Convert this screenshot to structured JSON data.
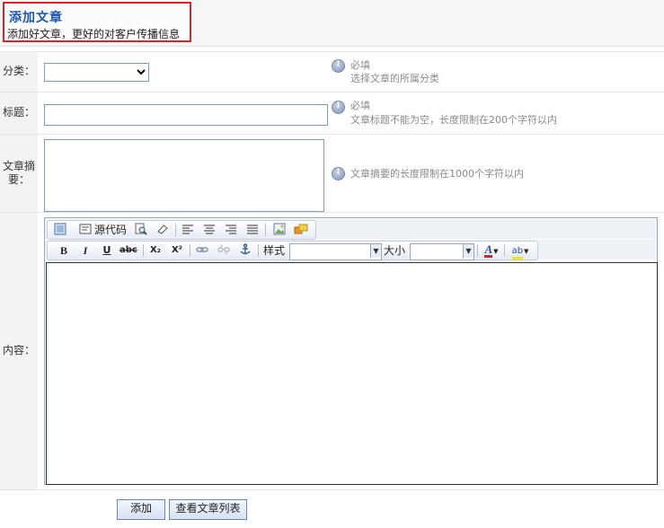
{
  "header": {
    "title": "添加文章",
    "subtitle": "添加好文章，更好的对客户传播信息"
  },
  "form": {
    "category": {
      "label": "分类：",
      "selected": "",
      "hint_required": "必填",
      "hint_text": "选择文章的所属分类"
    },
    "title_field": {
      "label": "标题：",
      "value": "",
      "hint_required": "必填",
      "hint_text": "文章标题不能为空，长度限制在200个字符以内"
    },
    "summary": {
      "label_line1": "文章摘",
      "label_line2": "要：",
      "value": "",
      "hint_text": "文章摘要的长度限制在1000个字符以内"
    },
    "content": {
      "label": "内容："
    }
  },
  "editor": {
    "toolbar_row1": [
      {
        "name": "template-icon"
      },
      {
        "name": "source-code-icon",
        "label": "源代码"
      },
      {
        "name": "preview-icon"
      },
      {
        "name": "eraser-icon"
      },
      {
        "name": "align-left-icon"
      },
      {
        "name": "align-center-icon"
      },
      {
        "name": "align-right-icon"
      },
      {
        "name": "align-justify-icon"
      },
      {
        "name": "image-icon"
      },
      {
        "name": "flash-icon"
      }
    ],
    "toolbar_row2": {
      "bold": "B",
      "italic": "I",
      "underline": "U",
      "strike": "abc",
      "subscript": "X₂",
      "superscript": "X²",
      "style_label": "样式",
      "style_value": "",
      "size_label": "大小",
      "size_value": "",
      "font_color_glyph": "A",
      "bg_color_glyph": "ab"
    },
    "content": ""
  },
  "actions": {
    "add_label": "添加",
    "list_label": "查看文章列表"
  },
  "colors": {
    "title_blue": "#1a55b0",
    "highlight_border": "#d9242b",
    "label_bg": "#f3f3f3"
  }
}
